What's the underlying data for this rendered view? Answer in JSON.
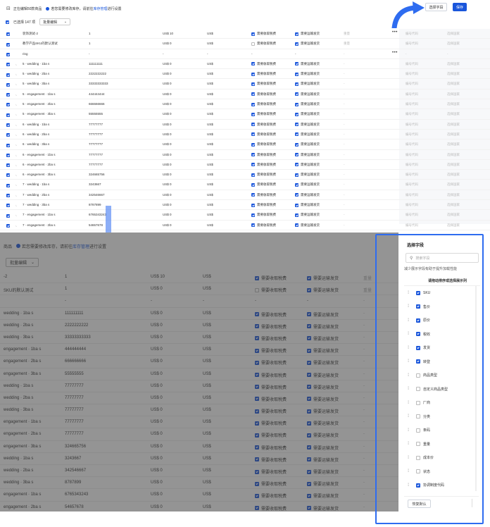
{
  "top": {
    "back_icon": "back-arrow-icon",
    "editing_label": "正在编辑50款商品",
    "notice_prefix": "若您需要修改库存，请前往",
    "notice_link": "库存管理",
    "notice_suffix": "进行设置",
    "select_fields_label": "选择字段",
    "save_label": "保存",
    "selected_label": "已选择 147 项",
    "bulk_edit_label": "批量编辑",
    "rows": [
      {
        "checked": true,
        "indent": "",
        "name": "装饰测试-2",
        "sku": "1",
        "price": "US$ 10",
        "cost": "US$",
        "tax": true,
        "ship": true,
        "weight": "重量",
        "dots": "•••",
        "hs": "编号代码",
        "origin": "选择国家"
      },
      {
        "checked": true,
        "indent": "",
        "name": "教学产品SKU的默认测试",
        "sku": "1",
        "price": "US$ 0",
        "cost": "US$",
        "tax": false,
        "ship": true,
        "weight": "重量",
        "dots": "",
        "hs": "编号代码",
        "origin": "选择国家"
      },
      {
        "checked": true,
        "indent": "",
        "name": "ring",
        "sku": "-",
        "price": "-",
        "cost": "-",
        "tax": null,
        "ship": null,
        "weight": "-",
        "dots": "•••",
        "hs": "-",
        "origin": "-"
      },
      {
        "checked": true,
        "indent": "⌞",
        "name": "5 · wedding · 1ba s",
        "sku": "111111111",
        "price": "US$ 0",
        "cost": "US$",
        "tax": true,
        "ship": true,
        "weight": "-",
        "dots": "",
        "hs": "编号代码",
        "origin": "选择国家"
      },
      {
        "checked": true,
        "indent": "⌞",
        "name": "5 · wedding · 2ba s",
        "sku": "2222222222",
        "price": "US$ 0",
        "cost": "US$",
        "tax": true,
        "ship": true,
        "weight": "-",
        "dots": "",
        "hs": "编号代码",
        "origin": "选择国家"
      },
      {
        "checked": true,
        "indent": "⌞",
        "name": "5 · wedding · 3ba s",
        "sku": "33333333333",
        "price": "US$ 0",
        "cost": "US$",
        "tax": true,
        "ship": true,
        "weight": "-",
        "dots": "",
        "hs": "编号代码",
        "origin": "选择国家"
      },
      {
        "checked": true,
        "indent": "⌞",
        "name": "5 · engagement · 1ba s",
        "sku": "444444444",
        "price": "US$ 0",
        "cost": "US$",
        "tax": true,
        "ship": true,
        "weight": "-",
        "dots": "",
        "hs": "编号代码",
        "origin": "选择国家"
      },
      {
        "checked": true,
        "indent": "⌞",
        "name": "5 · engagement · 2ba s",
        "sku": "666666666",
        "price": "US$ 0",
        "cost": "US$",
        "tax": true,
        "ship": true,
        "weight": "-",
        "dots": "",
        "hs": "编号代码",
        "origin": "选择国家"
      },
      {
        "checked": true,
        "indent": "⌞",
        "name": "5 · engagement · 3ba s",
        "sku": "55555555",
        "price": "US$ 0",
        "cost": "US$",
        "tax": true,
        "ship": true,
        "weight": "-",
        "dots": "",
        "hs": "编号代码",
        "origin": "选择国家"
      },
      {
        "checked": true,
        "indent": "⌞",
        "name": "6 · wedding · 1ba s",
        "sku": "77777777",
        "price": "US$ 0",
        "cost": "US$",
        "tax": true,
        "ship": true,
        "weight": "-",
        "dots": "",
        "hs": "编号代码",
        "origin": "选择国家"
      },
      {
        "checked": true,
        "indent": "⌞",
        "name": "6 · wedding · 2ba s",
        "sku": "77777777",
        "price": "US$ 0",
        "cost": "US$",
        "tax": true,
        "ship": true,
        "weight": "-",
        "dots": "",
        "hs": "编号代码",
        "origin": "选择国家"
      },
      {
        "checked": true,
        "indent": "⌞",
        "name": "6 · wedding · 3ba s",
        "sku": "77777777",
        "price": "US$ 0",
        "cost": "US$",
        "tax": true,
        "ship": true,
        "weight": "-",
        "dots": "",
        "hs": "编号代码",
        "origin": "选择国家"
      },
      {
        "checked": true,
        "indent": "⌞",
        "name": "6 · engagement · 1ba s",
        "sku": "77777777",
        "price": "US$ 0",
        "cost": "US$",
        "tax": true,
        "ship": true,
        "weight": "-",
        "dots": "",
        "hs": "编号代码",
        "origin": "选择国家"
      },
      {
        "checked": true,
        "indent": "⌞",
        "name": "6 · engagement · 2ba s",
        "sku": "77777777",
        "price": "US$ 0",
        "cost": "US$",
        "tax": true,
        "ship": true,
        "weight": "-",
        "dots": "",
        "hs": "编号代码",
        "origin": "选择国家"
      },
      {
        "checked": true,
        "indent": "⌞",
        "name": "6 · engagement · 3ba s",
        "sku": "324665756",
        "price": "US$ 0",
        "cost": "US$",
        "tax": true,
        "ship": true,
        "weight": "-",
        "dots": "",
        "hs": "编号代码",
        "origin": "选择国家"
      },
      {
        "checked": true,
        "indent": "⌞",
        "name": "7 · wedding · 1ba s",
        "sku": "3243667",
        "price": "US$ 0",
        "cost": "US$",
        "tax": true,
        "ship": true,
        "weight": "-",
        "dots": "",
        "hs": "编号代码",
        "origin": "选择国家"
      },
      {
        "checked": true,
        "indent": "⌞",
        "name": "7 · wedding · 2ba s",
        "sku": "342546667",
        "price": "US$ 0",
        "cost": "US$",
        "tax": true,
        "ship": true,
        "weight": "-",
        "dots": "",
        "hs": "编号代码",
        "origin": "选择国家"
      },
      {
        "checked": true,
        "indent": "⌞",
        "name": "7 · wedding · 3ba s",
        "sku": "8787899",
        "price": "US$ 0",
        "cost": "US$",
        "tax": true,
        "ship": true,
        "weight": "-",
        "dots": "",
        "hs": "编号代码",
        "origin": "选择国家"
      },
      {
        "checked": true,
        "indent": "⌞",
        "name": "7 · engagement · 1ba s",
        "sku": "6765343243",
        "price": "US$ 0",
        "cost": "US$",
        "tax": true,
        "ship": true,
        "weight": "-",
        "dots": "",
        "hs": "编号代码",
        "origin": "选择国家"
      },
      {
        "checked": true,
        "indent": "⌞",
        "name": "7 · engagement · 2ba s",
        "sku": "54657678",
        "price": "US$ 0",
        "cost": "US$",
        "tax": true,
        "ship": true,
        "weight": "-",
        "dots": "",
        "hs": "编号代码",
        "origin": "选择国家"
      }
    ],
    "tax_label": "需要收取税费",
    "ship_label": "需要运输发货"
  },
  "bottom": {
    "editing_label": "商品",
    "notice_prefix": "若您需要修改库存，请前往",
    "notice_link": "库存管理",
    "notice_suffix": "进行设置",
    "bulk_edit_label": "批量编辑",
    "rows": [
      {
        "name": "-2",
        "sku": "1",
        "price": "US$ 10",
        "cost": "US$",
        "tax": true,
        "ship": true,
        "weight": "重量"
      },
      {
        "name": "SKU的默认测试",
        "sku": "1",
        "price": "US$ 0",
        "cost": "US$",
        "tax": false,
        "ship": true,
        "weight": "重量"
      },
      {
        "name": "",
        "sku": "-",
        "price": "-",
        "cost": "-",
        "tax": null,
        "ship": null,
        "weight": "-"
      },
      {
        "name": "wedding · 1ba s",
        "sku": "111111111",
        "price": "US$ 0",
        "cost": "US$",
        "tax": true,
        "ship": true,
        "weight": "-"
      },
      {
        "name": "wedding · 2ba s",
        "sku": "2222222222",
        "price": "US$ 0",
        "cost": "US$",
        "tax": true,
        "ship": true,
        "weight": "-"
      },
      {
        "name": "wedding · 3ba s",
        "sku": "33333333333",
        "price": "US$ 0",
        "cost": "US$",
        "tax": true,
        "ship": true,
        "weight": "-"
      },
      {
        "name": "engagement · 1ba s",
        "sku": "444444444",
        "price": "US$ 0",
        "cost": "US$",
        "tax": true,
        "ship": true,
        "weight": "-"
      },
      {
        "name": "engagement · 2ba s",
        "sku": "666666666",
        "price": "US$ 0",
        "cost": "US$",
        "tax": true,
        "ship": true,
        "weight": "-"
      },
      {
        "name": "engagement · 3ba s",
        "sku": "55555555",
        "price": "US$ 0",
        "cost": "US$",
        "tax": true,
        "ship": true,
        "weight": "-"
      },
      {
        "name": "wedding · 1ba s",
        "sku": "77777777",
        "price": "US$ 0",
        "cost": "US$",
        "tax": true,
        "ship": true,
        "weight": "-"
      },
      {
        "name": "wedding · 2ba s",
        "sku": "77777777",
        "price": "US$ 0",
        "cost": "US$",
        "tax": true,
        "ship": true,
        "weight": "-"
      },
      {
        "name": "wedding · 3ba s",
        "sku": "77777777",
        "price": "US$ 0",
        "cost": "US$",
        "tax": true,
        "ship": true,
        "weight": "-"
      },
      {
        "name": "engagement · 1ba s",
        "sku": "77777777",
        "price": "US$ 0",
        "cost": "US$",
        "tax": true,
        "ship": true,
        "weight": "-"
      },
      {
        "name": "engagement · 2ba s",
        "sku": "77777777",
        "price": "US$ 0",
        "cost": "US$",
        "tax": true,
        "ship": true,
        "weight": "-"
      },
      {
        "name": "engagement · 3ba s",
        "sku": "324665756",
        "price": "US$ 0",
        "cost": "US$",
        "tax": true,
        "ship": true,
        "weight": "-"
      },
      {
        "name": "wedding · 1ba s",
        "sku": "3243667",
        "price": "US$ 0",
        "cost": "US$",
        "tax": true,
        "ship": true,
        "weight": "-"
      },
      {
        "name": "wedding · 2ba s",
        "sku": "342546667",
        "price": "US$ 0",
        "cost": "US$",
        "tax": true,
        "ship": true,
        "weight": "-"
      },
      {
        "name": "wedding · 3ba s",
        "sku": "8787899",
        "price": "US$ 0",
        "cost": "US$",
        "tax": true,
        "ship": true,
        "weight": "-"
      },
      {
        "name": "engagement · 1ba s",
        "sku": "6765343243",
        "price": "US$ 0",
        "cost": "US$",
        "tax": true,
        "ship": true,
        "weight": "-"
      },
      {
        "name": "engagement · 2ba s",
        "sku": "54657678",
        "price": "US$ 0",
        "cost": "US$",
        "tax": true,
        "ship": true,
        "weight": "-"
      }
    ]
  },
  "drawer": {
    "title": "选择字段",
    "search_placeholder": "搜索字段",
    "hint": "减少展示字段有助于提升加载性能",
    "sub": "请拖动排序或选择展示列",
    "items": [
      {
        "label": "SKU",
        "checked": true
      },
      {
        "label": "售价",
        "checked": true
      },
      {
        "label": "原价",
        "checked": true
      },
      {
        "label": "税收",
        "checked": true
      },
      {
        "label": "发货",
        "checked": true
      },
      {
        "label": "转登",
        "checked": true
      },
      {
        "label": "商品类型",
        "checked": false
      },
      {
        "label": "自定义商品类型",
        "checked": false
      },
      {
        "label": "厂商",
        "checked": false
      },
      {
        "label": "分类",
        "checked": false
      },
      {
        "label": "条码",
        "checked": false
      },
      {
        "label": "重量",
        "checked": false
      },
      {
        "label": "成本价",
        "checked": false
      },
      {
        "label": "状态",
        "checked": false
      },
      {
        "label": "协调制度代码",
        "checked": true
      }
    ],
    "reset_label": "恢复默认"
  },
  "colors": {
    "accent": "#1a56db",
    "outline": "#2e6cf0"
  }
}
